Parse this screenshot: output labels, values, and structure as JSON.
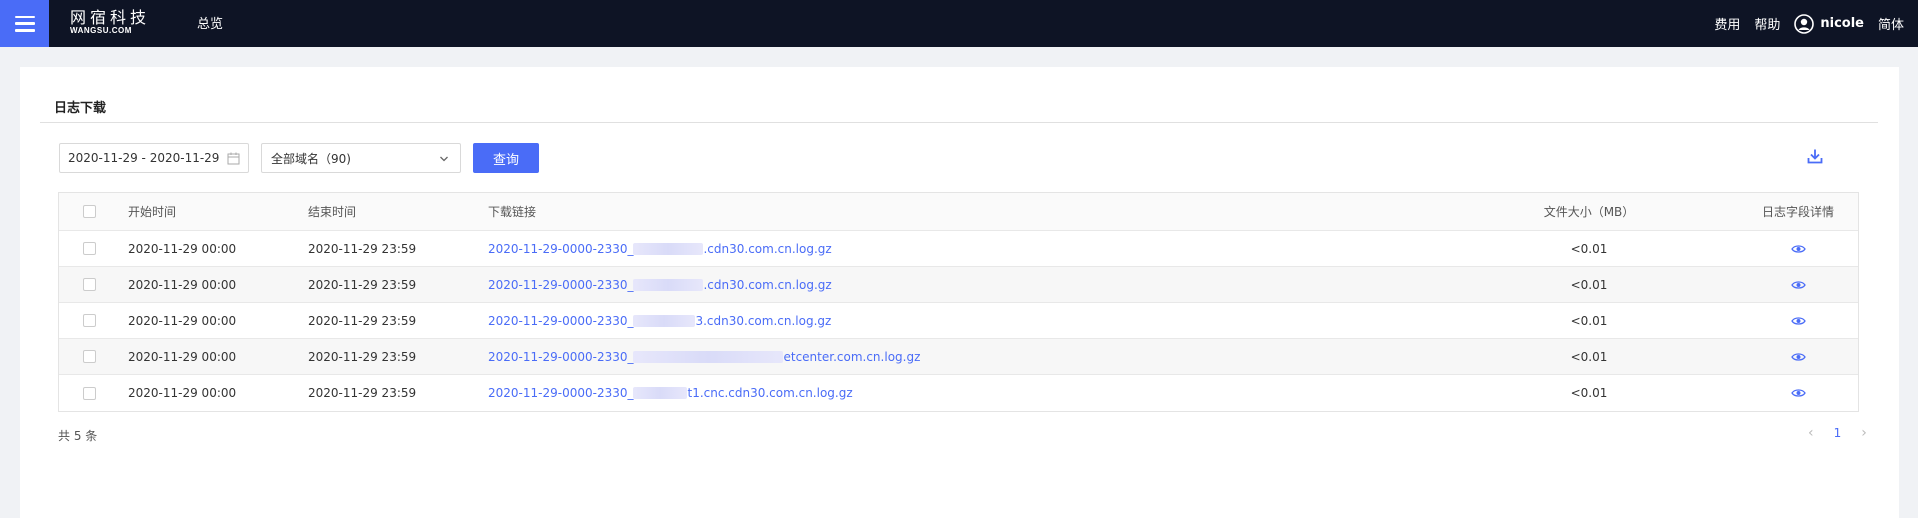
{
  "header": {
    "logo_cn": "网宿科技",
    "logo_en": "WANGSU.COM",
    "nav_overview": "总览",
    "links": [
      "费用",
      "帮助"
    ],
    "username": "nicole",
    "language": "简体"
  },
  "page": {
    "title": "日志下载"
  },
  "filters": {
    "date_range": "2020-11-29 - 2020-11-29",
    "domain_select": "全部域名（90)",
    "query_label": "查询"
  },
  "table": {
    "columns": [
      "开始时间",
      "结束时间",
      "下载链接",
      "文件大小（MB）",
      "日志字段详情"
    ],
    "rows": [
      {
        "start": "2020-11-29 00:00",
        "end": "2020-11-29 23:59",
        "link_prefix": "2020-11-29-0000-2330_",
        "link_suffix": ".cdn30.com.cn.log.gz",
        "size": "<0.01"
      },
      {
        "start": "2020-11-29 00:00",
        "end": "2020-11-29 23:59",
        "link_prefix": "2020-11-29-0000-2330_",
        "link_suffix": ".cdn30.com.cn.log.gz",
        "size": "<0.01"
      },
      {
        "start": "2020-11-29 00:00",
        "end": "2020-11-29 23:59",
        "link_prefix": "2020-11-29-0000-2330_",
        "link_suffix": "3.cdn30.com.cn.log.gz",
        "size": "<0.01"
      },
      {
        "start": "2020-11-29 00:00",
        "end": "2020-11-29 23:59",
        "link_prefix": "2020-11-29-0000-2330_",
        "link_suffix": "etcenter.com.cn.log.gz",
        "size": "<0.01"
      },
      {
        "start": "2020-11-29 00:00",
        "end": "2020-11-29 23:59",
        "link_prefix": "2020-11-29-0000-2330_",
        "link_suffix": "t1.cnc.cdn30.com.cn.log.gz",
        "size": "<0.01"
      }
    ]
  },
  "footer": {
    "total": "共 5 条",
    "current_page": "1"
  },
  "colors": {
    "accent": "#4a6cf7",
    "topbar": "#0e1425"
  }
}
